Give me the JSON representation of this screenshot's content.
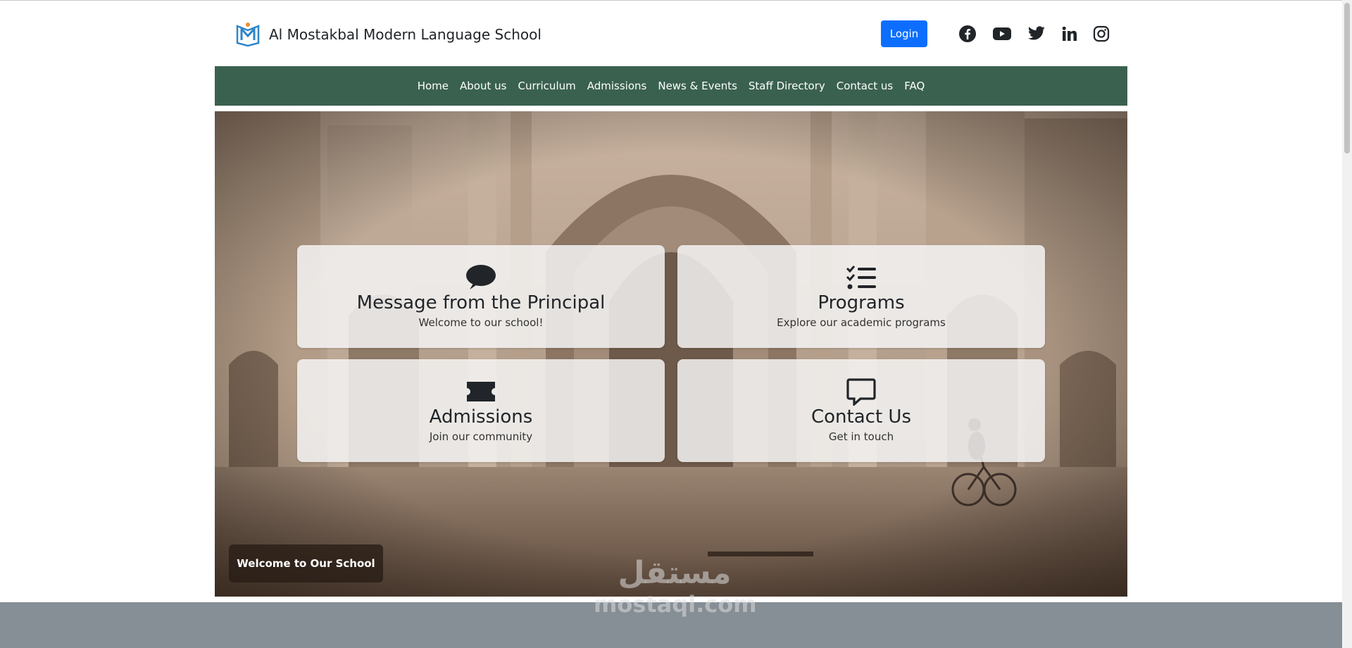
{
  "header": {
    "brand": "Al Mostakbal Modern Language School",
    "login_label": "Login",
    "social_icons": [
      "facebook-icon",
      "youtube-icon",
      "twitter-icon",
      "linkedin-icon",
      "instagram-icon"
    ]
  },
  "nav": {
    "items": [
      "Home",
      "About us",
      "Curriculum",
      "Admissions",
      "News & Events",
      "Staff Directory",
      "Contact us",
      "FAQ"
    ]
  },
  "cards": [
    {
      "title": "Message from the Principal",
      "subtitle": "Welcome to our school!",
      "icon": "chat-bubble-icon"
    },
    {
      "title": "Programs",
      "subtitle": "Explore our academic programs",
      "icon": "checklist-icon"
    },
    {
      "title": "Admissions",
      "subtitle": "Join our community",
      "icon": "ticket-icon"
    },
    {
      "title": "Contact Us",
      "subtitle": "Get in touch",
      "icon": "chat-outline-icon"
    }
  ],
  "hero": {
    "badge": "Welcome to Our School"
  },
  "watermark": {
    "arabic": "مستقل",
    "latin": "mostaql.com"
  },
  "colors": {
    "nav_bg": "#3a6150",
    "login_bg": "#0d6efd",
    "footer_bg": "#868e96"
  }
}
